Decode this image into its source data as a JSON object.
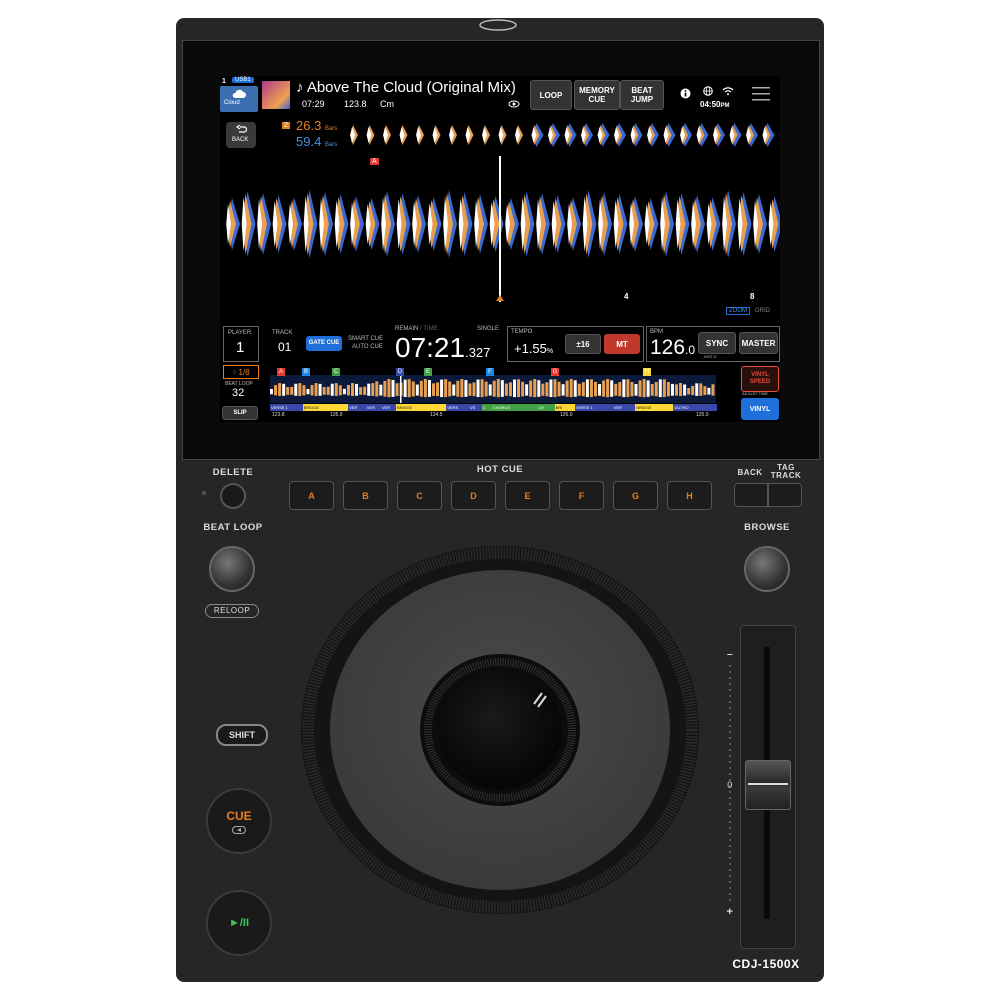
{
  "screen": {
    "deck_number": "1",
    "source": "USB1",
    "source_icon_label": "Cloud",
    "track_title": "♪ Above The Cloud (Original Mix)",
    "track_time": "07:29",
    "track_bpm": "123.8",
    "track_key": "Cm",
    "top_buttons": {
      "loop": "LOOP",
      "memory_cue": "MEMORY CUE",
      "beat_jump": "BEAT JUMP"
    },
    "clock": "04:50",
    "clock_suffix": "PM",
    "back": "BACK",
    "bars_primary_index": "2",
    "bars_primary": "26.3",
    "bars_primary_unit": "Bars",
    "bars_secondary": "59.4",
    "bars_secondary_unit": "Bars",
    "marker_a": "A",
    "beat_4": "4",
    "beat_8": "8",
    "zoom": "ZOOM",
    "grid": "GRID",
    "player_label": "PLAYER",
    "player_number": "1",
    "track_label": "TRACK",
    "track_number": "01",
    "gate_cue": "GATE CUE",
    "smart_cue": "SMART CUE",
    "auto_cue": "AUTO CUE",
    "remain_label": "REMAIN",
    "time_label": "/ TIME",
    "single": "SINGLE",
    "remain_main": "07:21",
    "remain_frac": ".327",
    "tempo_label": "TEMPO",
    "tempo_value": "+1.55",
    "tempo_unit": "%",
    "tempo_range": "±16",
    "mt": "MT",
    "bpm_label": "BPM",
    "bpm_main": "126",
    "bpm_frac": ".0",
    "sync": "SYNC",
    "master": "MASTER",
    "inst_label": "INST.D",
    "loop_fraction": "1/8",
    "beat_loop_label": "BEAT LOOP",
    "beat_loop_value": "32",
    "slip": "SLIP",
    "vinyl_speed": "VINYL SPEED",
    "adjust_time": "ADJUST TIME",
    "vinyl": "VINYL",
    "cue_letters": [
      "A",
      "B",
      "C",
      "D",
      "E",
      "F",
      "G",
      "H"
    ],
    "cue_colors": [
      "#e53935",
      "#1e88e5",
      "#43a047",
      "#3949ab",
      "#43a047",
      "#1e88e5",
      "#e53935",
      "#fdd835"
    ],
    "phrase_labels": [
      "VERSE 1",
      "BRIDGE",
      "VER",
      "VER",
      "VER",
      "BRIDGE",
      "VERS",
      "VE",
      "C",
      "CHORUS",
      "CH",
      "BRI",
      "VERSE 1",
      "VER",
      "BRIDGE",
      "OUTRO"
    ],
    "phrase_bpms": [
      "123.8",
      "126.9",
      "124.5",
      "126.0",
      "125.0"
    ]
  },
  "controls": {
    "delete": "DELETE",
    "hot_cue": "HOT CUE",
    "hot_cue_pads": [
      "A",
      "B",
      "C",
      "D",
      "E",
      "F",
      "G",
      "H"
    ],
    "back": "BACK",
    "tag_track": "TAG TRACK",
    "beat_loop": "BEAT LOOP",
    "reloop": "RELOOP",
    "browse": "BROWSE",
    "shift": "SHIFT",
    "cue": "CUE",
    "play_pause": "►/II",
    "tempo_minus": "–",
    "tempo_zero": "0",
    "tempo_plus": "+",
    "model": "CDJ-1500X"
  },
  "colors": {
    "accent_orange": "#e87d1e",
    "accent_green": "#3dc45a",
    "screen_blue": "#1e6fd9",
    "mt_red": "#c0392b"
  }
}
